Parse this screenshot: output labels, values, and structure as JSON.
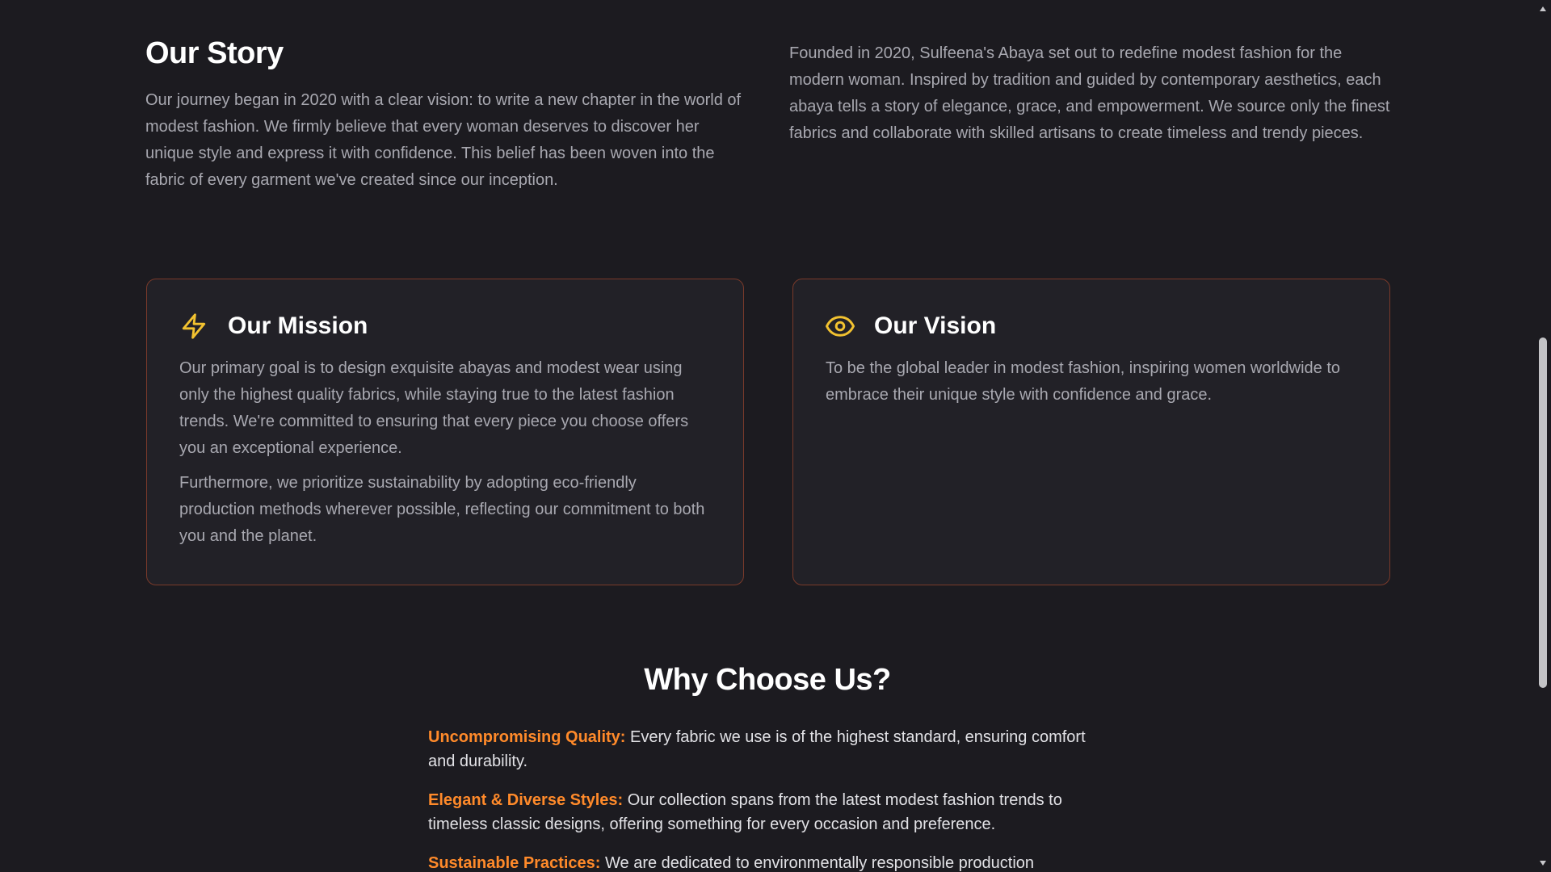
{
  "story": {
    "title": "Our Story",
    "left_text": "Our journey began in 2020 with a clear vision: to write a new chapter in the world of modest fashion. We firmly believe that every woman deserves to discover her unique style and express it with confidence. This belief has been woven into the fabric of every garment we've created since our inception.",
    "right_text": "Founded in 2020, Sulfeena's Abaya set out to redefine modest fashion for the modern woman. Inspired by tradition and guided by contemporary aesthetics, each abaya tells a story of elegance, grace, and empowerment. We source only the finest fabrics and collaborate with skilled artisans to create timeless and trendy pieces."
  },
  "mission": {
    "icon": "lightning-bolt-icon",
    "title": "Our Mission",
    "p1": "Our primary goal is to design exquisite abayas and modest wear using only the highest quality fabrics, while staying true to the latest fashion trends. We're committed to ensuring that every piece you choose offers you an exceptional experience.",
    "p2": "Furthermore, we prioritize sustainability by adopting eco-friendly production methods wherever possible, reflecting our commitment to both you and the planet."
  },
  "vision": {
    "icon": "eye-icon",
    "title": "Our Vision",
    "p1": "To be the global leader in modest fashion, inspiring women worldwide to embrace their unique style with confidence and grace."
  },
  "why": {
    "title": "Why Choose Us?",
    "items": [
      {
        "label": "Uncompromising Quality:",
        "text": " Every fabric we use is of the highest standard, ensuring comfort and durability."
      },
      {
        "label": "Elegant & Diverse Styles:",
        "text": " Our collection spans from the latest modest fashion trends to timeless classic designs, offering something for every occasion and preference."
      },
      {
        "label": "Sustainable Practices:",
        "text": " We are dedicated to environmentally responsible production"
      }
    ]
  },
  "colors": {
    "background": "#1c1b20",
    "card_background": "#222127",
    "card_border": "#7a3a2a",
    "icon_accent": "#f2c230",
    "highlight": "#ff8a2a",
    "heading": "#ffffff",
    "body_text": "#a8a8b0"
  }
}
